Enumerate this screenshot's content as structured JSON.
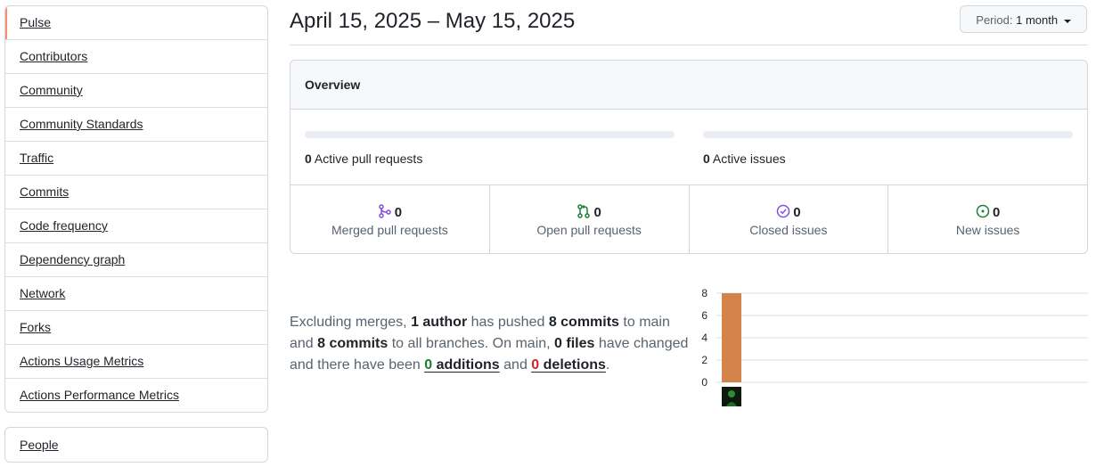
{
  "sidebar": {
    "items": [
      {
        "label": "Pulse",
        "selected": true
      },
      {
        "label": "Contributors"
      },
      {
        "label": "Community"
      },
      {
        "label": "Community Standards"
      },
      {
        "label": "Traffic"
      },
      {
        "label": "Commits"
      },
      {
        "label": "Code frequency"
      },
      {
        "label": "Dependency graph"
      },
      {
        "label": "Network"
      },
      {
        "label": "Forks"
      },
      {
        "label": "Actions Usage Metrics"
      },
      {
        "label": "Actions Performance Metrics"
      }
    ],
    "secondary": [
      {
        "label": "People"
      }
    ]
  },
  "header": {
    "date_range": "April 15, 2025 – May 15, 2025",
    "period_label": "Period:",
    "period_value": "1 month"
  },
  "overview": {
    "title": "Overview",
    "active_prs": {
      "count": "0",
      "text": "Active pull requests"
    },
    "active_issues": {
      "count": "0",
      "text": "Active issues"
    },
    "stats": [
      {
        "value": "0",
        "label": "Merged pull requests",
        "icon": "git-merge-icon",
        "color": "#8250df"
      },
      {
        "value": "0",
        "label": "Open pull requests",
        "icon": "git-pull-request-icon",
        "color": "#1a7f37"
      },
      {
        "value": "0",
        "label": "Closed issues",
        "icon": "issue-closed-icon",
        "color": "#8250df"
      },
      {
        "value": "0",
        "label": "New issues",
        "icon": "issue-opened-icon",
        "color": "#1a7f37"
      }
    ]
  },
  "summary": {
    "p1": "Excluding merges, ",
    "authors": "1 author",
    "p2": " has pushed ",
    "commits_main": "8 commits",
    "p3": " to main and ",
    "commits_all": "8 commits",
    "p4": " to all branches. On main, ",
    "files": "0 files",
    "p5": " have changed and there have been ",
    "additions_num": "0",
    "additions_word": " additions",
    "p6": " and ",
    "deletions_num": "0",
    "deletions_word": " deletions",
    "p7": "."
  },
  "chart_data": {
    "type": "bar",
    "categories": [
      ""
    ],
    "values": [
      8
    ],
    "ylim": [
      0,
      8
    ],
    "yticks": [
      0,
      2,
      4,
      6,
      8
    ],
    "grid": true,
    "bar_color": "#d4844a"
  }
}
